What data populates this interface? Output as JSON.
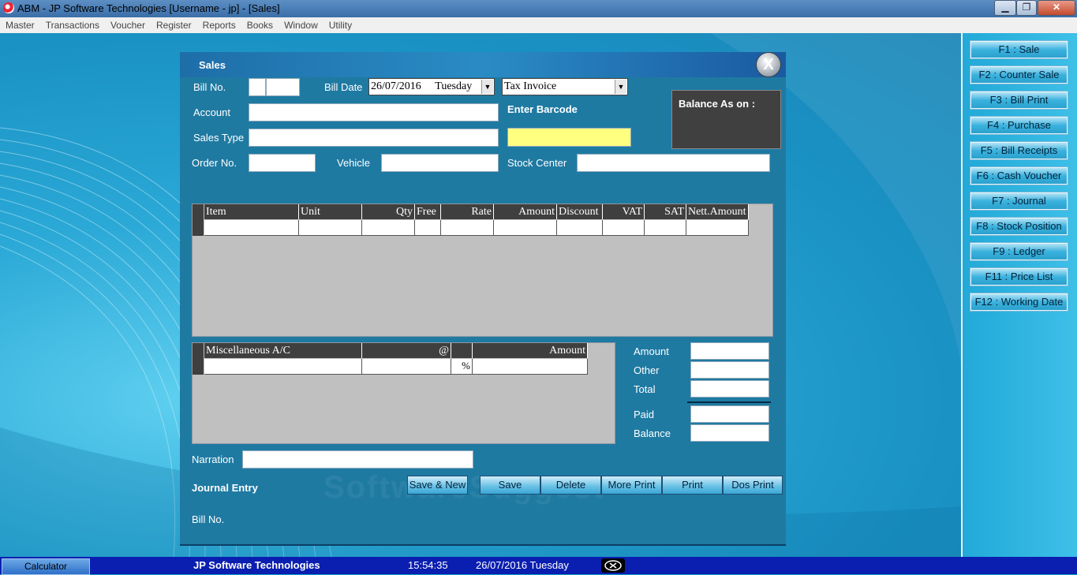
{
  "window": {
    "title": "ABM - JP Software Technologies   [Username - jp] - [Sales]",
    "min": "▁",
    "restore": "❐",
    "close": "✕"
  },
  "menu": [
    "Master",
    "Transactions",
    "Voucher",
    "Register",
    "Reports",
    "Books",
    "Window",
    "Utility"
  ],
  "form": {
    "title": "Sales",
    "close_label": "X",
    "bill_no_label": "Bill No.",
    "bill_date_label": "Bill Date",
    "bill_date_value": "26/07/2016",
    "bill_day_value": "Tuesday",
    "invoice_type": "Tax Invoice",
    "account_label": "Account",
    "enter_barcode_label": "Enter Barcode",
    "sales_type_label": "Sales Type",
    "balance_label": "Balance As on :",
    "order_no_label": "Order No.",
    "vehicle_label": "Vehicle",
    "stock_center_label": "Stock Center",
    "narration_label": "Narration",
    "journal_entry_label": "Journal Entry",
    "footer_bill_no_label": "Bill No."
  },
  "items_grid": {
    "columns": [
      "Item",
      "Unit",
      "Qty",
      "Free",
      "Rate",
      "Amount",
      "Discount",
      "VAT",
      "SAT",
      "Nett.Amount"
    ]
  },
  "misc_grid": {
    "columns": [
      "Miscellaneous A/C",
      "@",
      "",
      "Amount"
    ],
    "row_percent": "%"
  },
  "totals": {
    "amount_label": "Amount",
    "other_label": "Other",
    "total_label": "Total",
    "paid_label": "Paid",
    "balance_label": "Balance"
  },
  "buttons": {
    "save_new": "Save & New",
    "save": "Save",
    "delete": "Delete",
    "more_print": "More Print",
    "print": "Print",
    "dos_print": "Dos Print"
  },
  "function_keys": [
    "F1 : Sale",
    "F2 : Counter Sale",
    "F3 : Bill Print",
    "F4 : Purchase",
    "F5 : Bill Receipts",
    "F6 : Cash Voucher",
    "F7 : Journal",
    "F8 : Stock Position",
    "F9 : Ledger",
    "F11 : Price List",
    "F12 : Working Date"
  ],
  "taskbar": {
    "calculator": "Calculator",
    "company": "JP Software Technologies",
    "time": "15:54:35",
    "date": "26/07/2016 Tuesday"
  },
  "colors": {
    "barcode_field": "#ffff80",
    "form_background": "#1f7aa2",
    "grid_background": "#c0c0c0"
  }
}
